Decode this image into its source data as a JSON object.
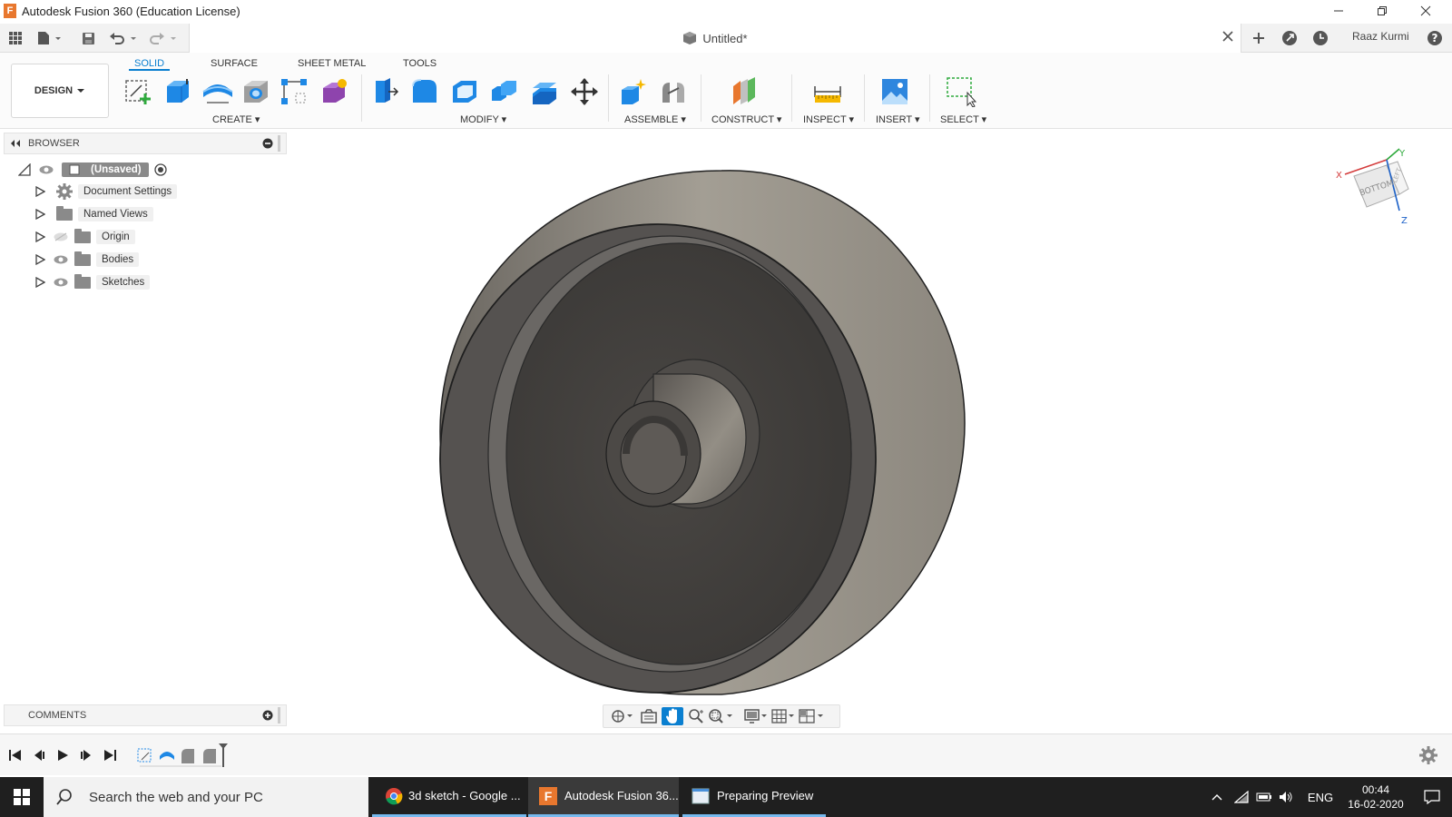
{
  "titlebar": {
    "title": "Autodesk Fusion 360 (Education License)",
    "app_letter": "F"
  },
  "document": {
    "title": "Untitled*"
  },
  "user": {
    "name": "Raaz Kurmi"
  },
  "workspace": {
    "label": "DESIGN"
  },
  "tabs": [
    {
      "label": "SOLID"
    },
    {
      "label": "SURFACE"
    },
    {
      "label": "SHEET METAL"
    },
    {
      "label": "TOOLS"
    }
  ],
  "groups": {
    "create": "CREATE",
    "modify": "MODIFY",
    "assemble": "ASSEMBLE",
    "construct": "CONSTRUCT",
    "inspect": "INSPECT",
    "insert": "INSERT",
    "select": "SELECT"
  },
  "browser": {
    "label": "BROWSER",
    "root": "(Unsaved)",
    "nodes": [
      {
        "label": "Document Settings"
      },
      {
        "label": "Named Views"
      },
      {
        "label": "Origin"
      },
      {
        "label": "Bodies"
      },
      {
        "label": "Sketches"
      }
    ]
  },
  "comments": {
    "label": "COMMENTS"
  },
  "viewcube": {
    "face": "BOTTOM",
    "side": "LEFT",
    "axis_x": "X",
    "axis_y": "Y",
    "axis_z": "Z"
  },
  "taskbar": {
    "search_placeholder": "Search the web and your PC",
    "apps": [
      {
        "label": "3d sketch - Google ..."
      },
      {
        "label": "Autodesk Fusion 36..."
      },
      {
        "label": "Preparing Preview"
      }
    ],
    "language": "ENG",
    "time": "00:44",
    "date": "16-02-2020"
  },
  "colors": {
    "accent": "#0a7fd0",
    "taskbar": "#1f1f1f",
    "fusion_orange": "#e8772e"
  }
}
